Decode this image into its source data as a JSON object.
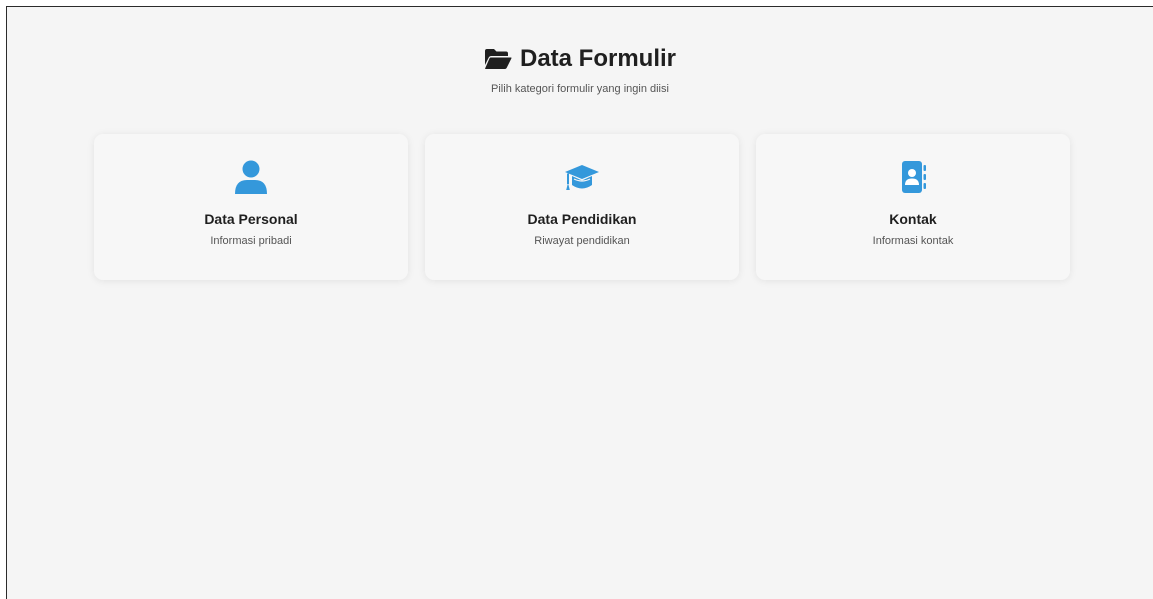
{
  "header": {
    "title": "Data Formulir",
    "subtitle": "Pilih kategori formulir yang ingin diisi",
    "icon": "folder-open-icon"
  },
  "cards": [
    {
      "title": "Data Personal",
      "description": "Informasi pribadi",
      "icon": "user-icon"
    },
    {
      "title": "Data Pendidikan",
      "description": "Riwayat pendidikan",
      "icon": "graduation-cap-icon"
    },
    {
      "title": "Kontak",
      "description": "Informasi kontak",
      "icon": "address-book-icon"
    }
  ],
  "colors": {
    "accent": "#3498db",
    "background": "#f5f5f5",
    "card": "#f7f7f7",
    "text": "#1f1f1f",
    "muted": "#555555"
  }
}
